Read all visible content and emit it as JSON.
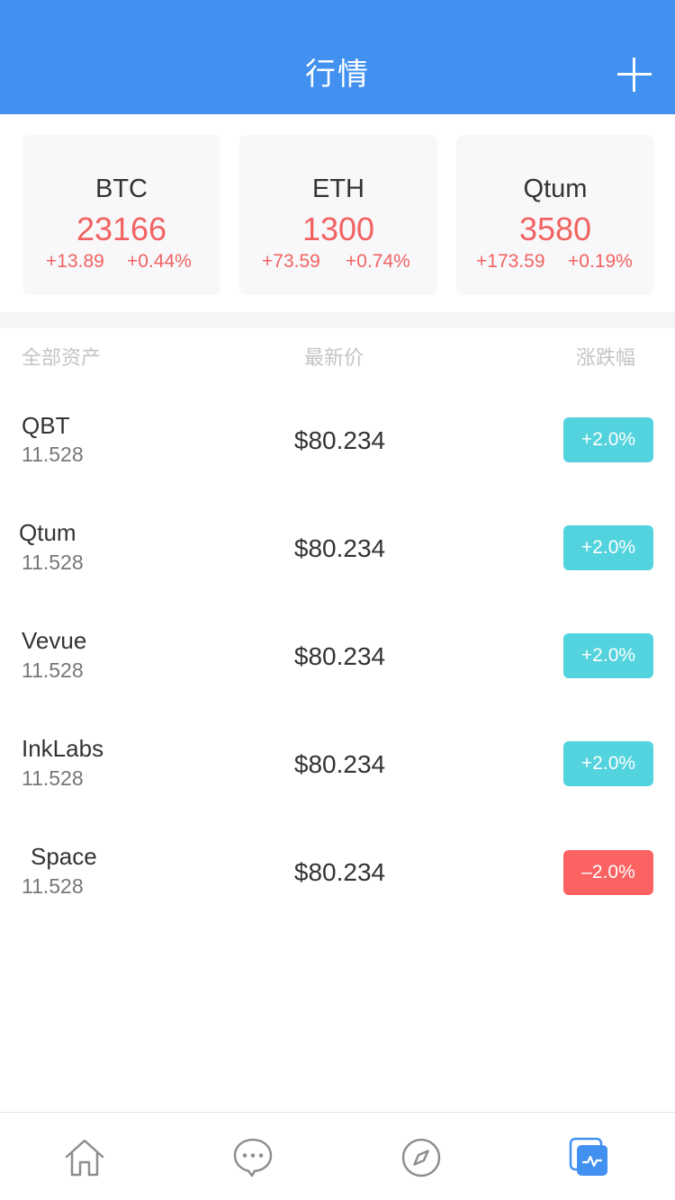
{
  "header": {
    "title": "行情",
    "add_icon": "plus-icon"
  },
  "tickers": [
    {
      "name": "BTC",
      "price": "23166",
      "change": "+13.89",
      "percent": "+0.44%"
    },
    {
      "name": "ETH",
      "price": "1300",
      "change": "+73.59",
      "percent": "+0.74%"
    },
    {
      "name": "Qtum",
      "price": "3580",
      "change": "+173.59",
      "percent": "+0.19%"
    }
  ],
  "columns": {
    "asset": "全部资产",
    "price": "最新价",
    "change": "涨跌幅"
  },
  "assets": [
    {
      "name": "QBT",
      "amount": "11.528",
      "price": "$80.234",
      "change": "+2.0%",
      "trend": "up"
    },
    {
      "name": "Qtum",
      "amount": "11.528",
      "price": "$80.234",
      "change": "+2.0%",
      "trend": "up"
    },
    {
      "name": "Vevue",
      "amount": "11.528",
      "price": "$80.234",
      "change": "+2.0%",
      "trend": "up"
    },
    {
      "name": "InkLabs",
      "amount": "11.528",
      "price": "$80.234",
      "change": "+2.0%",
      "trend": "up"
    },
    {
      "name": "Space",
      "amount": "11.528",
      "price": "$80.234",
      "change": "–2.0%",
      "trend": "down"
    }
  ],
  "colors": {
    "primary": "#4290f0",
    "rise_text": "#f26262",
    "badge_up": "#52d3dd",
    "badge_down": "#fb6262",
    "inactive_icon": "#8e8e8e"
  },
  "tabbar": {
    "icons": [
      "home-icon",
      "chat-icon",
      "compass-icon",
      "market-icon"
    ],
    "active": "market-icon"
  }
}
